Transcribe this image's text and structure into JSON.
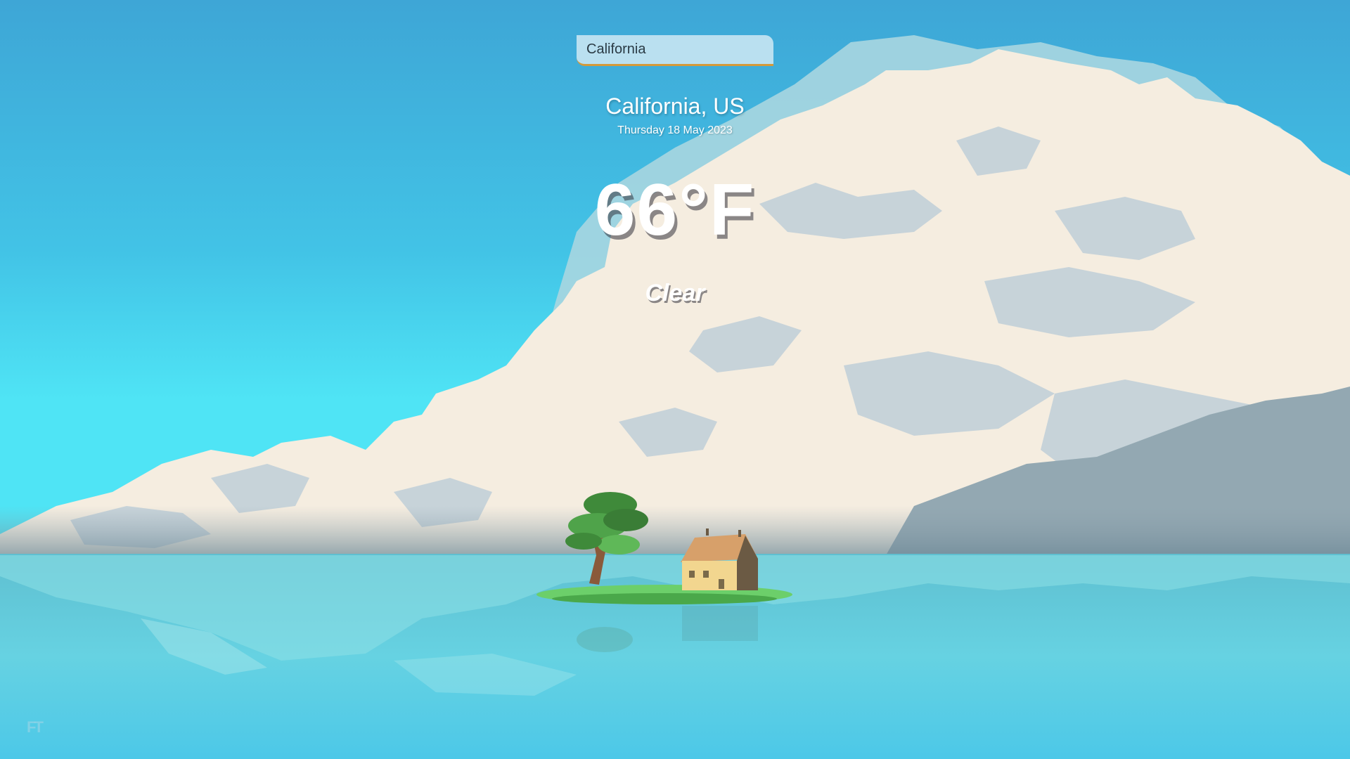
{
  "search": {
    "value": "California",
    "placeholder": ""
  },
  "weather": {
    "location": "California, US",
    "date": "Thursday 18 May 2023",
    "temperature": "66°F",
    "condition": "Clear"
  },
  "footer": {
    "logo_text": "FT"
  },
  "colors": {
    "sky_top": "#3ea6d6",
    "sky_bottom": "#4fe4f5",
    "cloud": "#f5ede0",
    "cloud_shadow": "#c7d3d9",
    "water": "#66cfe0",
    "search_accent": "#d49a3a"
  }
}
